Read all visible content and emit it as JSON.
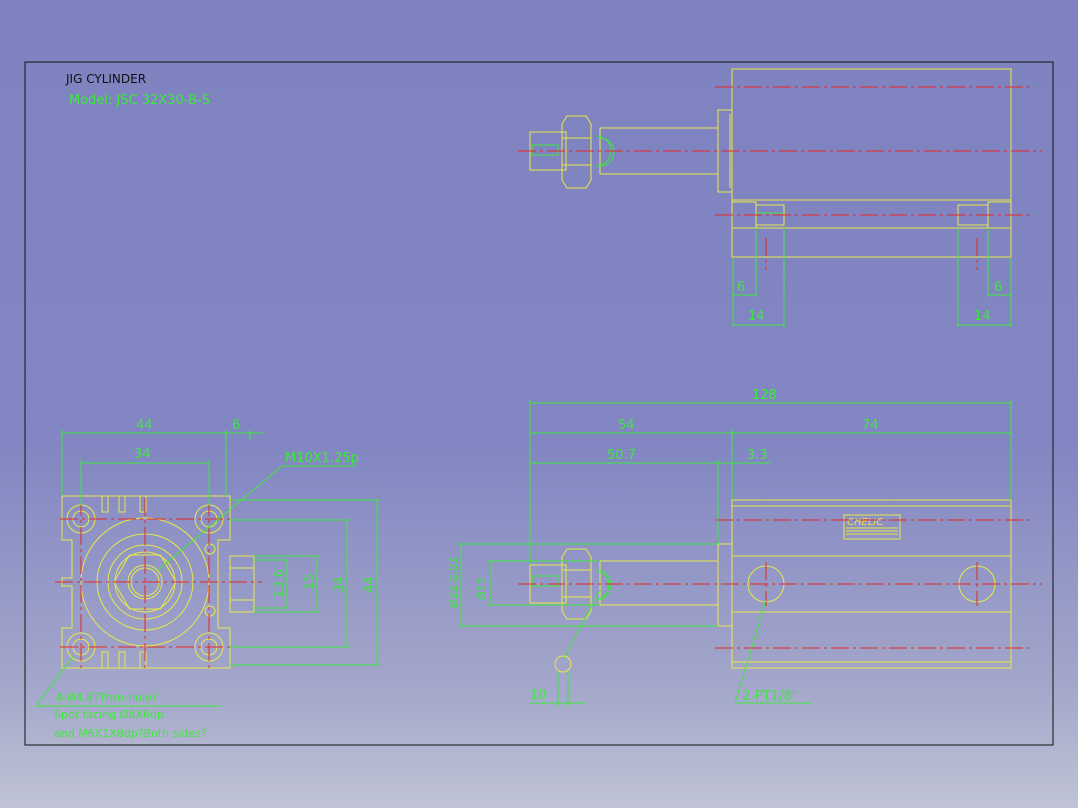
{
  "title": "JIG CYLINDER",
  "model": "Model: JSC 32X30-B-S",
  "logo_text": "CHELIC",
  "dims": {
    "d128": "128",
    "d54": "54",
    "d74": "74",
    "d50_7": "50.7",
    "d3_3": "3.3",
    "d44_top": "44",
    "d34_top": "34",
    "d6_top": "6",
    "m10": "M10X1.25p",
    "d13_6": "13.6",
    "d15": "15",
    "d34_right": "34",
    "d44_right": "44",
    "d6_a": "6",
    "d6_b": "6",
    "d14_a": "14",
    "d14_b": "14",
    "d10": "10",
    "dia12": "Ø12",
    "dia22": "Ø22-0.03",
    "port": "2-PT1/8\""
  },
  "notes": {
    "line1": "4-Ø4.8?Thru-hole?",
    "line2": "Spot facing  Ø8X6dp",
    "line3": "and M6X1X8dp?Both sides?"
  },
  "colors": {
    "geometry": "#e8e84a",
    "dimension": "#3ee83e",
    "centerline": "#e82626",
    "frame": "#000000"
  }
}
